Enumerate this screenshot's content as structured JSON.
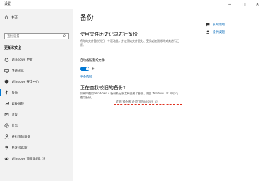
{
  "window": {
    "title": "设置",
    "controls": {
      "minimize": "−",
      "maximize": "□",
      "close": "✕"
    }
  },
  "sidebar": {
    "home_label": "主页",
    "search_placeholder": "查找设置",
    "section_title": "更新和安全",
    "items": [
      {
        "label": "Windows 更新",
        "icon": "sync-icon"
      },
      {
        "label": "传递优化",
        "icon": "delivery-optimization-icon"
      },
      {
        "label": "Windows 安全中心",
        "icon": "shield-icon"
      },
      {
        "label": "备份",
        "icon": "backup-arrow-icon",
        "selected": true
      },
      {
        "label": "疑难解答",
        "icon": "wrench-icon"
      },
      {
        "label": "恢复",
        "icon": "recovery-icon"
      },
      {
        "label": "激活",
        "icon": "check-circle-icon"
      },
      {
        "label": "查找我的设备",
        "icon": "person-location-icon"
      },
      {
        "label": "开发者选项",
        "icon": "developer-icon"
      },
      {
        "label": "Windows 预览体验计划",
        "icon": "insider-icon"
      }
    ]
  },
  "main": {
    "page_title": "备份",
    "file_history": {
      "heading": "使用文件历史记录进行备份",
      "description": "将你的文件备份到另一个驱动器，并在原始文件丢失、受损或被删除时对其进行还原。",
      "auto_backup_label": "自动备份我的文件",
      "toggle_state": "开",
      "more_options": "更多选项"
    },
    "older_backup": {
      "heading": "正在查找较旧的备份?",
      "description": "如果你使用 Windows 7 备份和还原工具创建了备份，则此 Windows 10 中仍可使用备份。",
      "link": "转到\"备份和还原\"(Windows 7)"
    }
  },
  "right_links": [
    {
      "label": "获取帮助",
      "icon": "help-chat-icon"
    },
    {
      "label": "提供反馈",
      "icon": "feedback-icon"
    }
  ],
  "colors": {
    "accent": "#0078d4",
    "link": "#0067b8",
    "highlight": "#e0301e"
  }
}
